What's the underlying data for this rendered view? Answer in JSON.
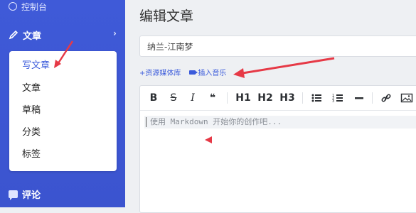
{
  "sidebar": {
    "dashboard_label": "控制台",
    "article_label": "文章",
    "submenu": [
      {
        "label": "写文章",
        "active": true
      },
      {
        "label": "文章"
      },
      {
        "label": "草稿"
      },
      {
        "label": "分类"
      },
      {
        "label": "标签"
      }
    ],
    "comment_label": "评论",
    "accent_color": "#3f5ad8"
  },
  "main": {
    "page_title": "编辑文章",
    "title_value": "纳兰-江南梦",
    "links": {
      "resource_library": "+资源媒体库",
      "insert_music": "插入音乐"
    },
    "toolbar": {
      "bold": "B",
      "strike": "S",
      "italic": "I",
      "quote": "❝",
      "h1": "H1",
      "h2": "H2",
      "h3": "H3"
    },
    "editor_placeholder": "使用 Markdown 开始你的创作吧..."
  }
}
